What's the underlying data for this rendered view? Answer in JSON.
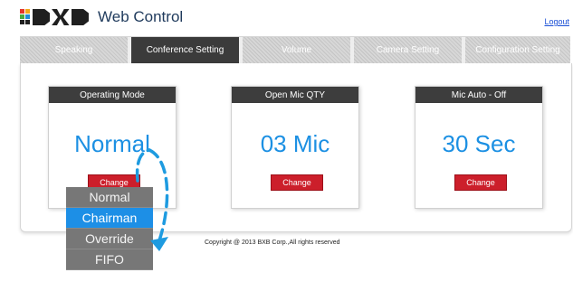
{
  "header": {
    "brand": "Web Control",
    "logout": "Logout"
  },
  "tabs": [
    {
      "label": "Speaking",
      "active": false
    },
    {
      "label": "Conference Setting",
      "active": true
    },
    {
      "label": "Volume",
      "active": false
    },
    {
      "label": "Camera Setting",
      "active": false
    },
    {
      "label": "Configuration Setting",
      "active": false
    }
  ],
  "cards": [
    {
      "title": "Operating Mode",
      "value": "Normal",
      "button": "Change"
    },
    {
      "title": "Open Mic QTY",
      "value": "03 Mic",
      "button": "Change"
    },
    {
      "title": "Mic Auto - Off",
      "value": "30 Sec",
      "button": "Change"
    }
  ],
  "dropdown": {
    "options": [
      "Normal",
      "Chairman",
      "Override",
      "FIFO"
    ],
    "selected": "Chairman"
  },
  "footer": {
    "copyright": "Copyright @ 2013 BXB Corp.,All rights reserved"
  },
  "colors": {
    "accent": "#1c90e3",
    "button": "#cc1f2b",
    "highlight": "#1d8fe6",
    "annotation": "#1e9be0"
  }
}
